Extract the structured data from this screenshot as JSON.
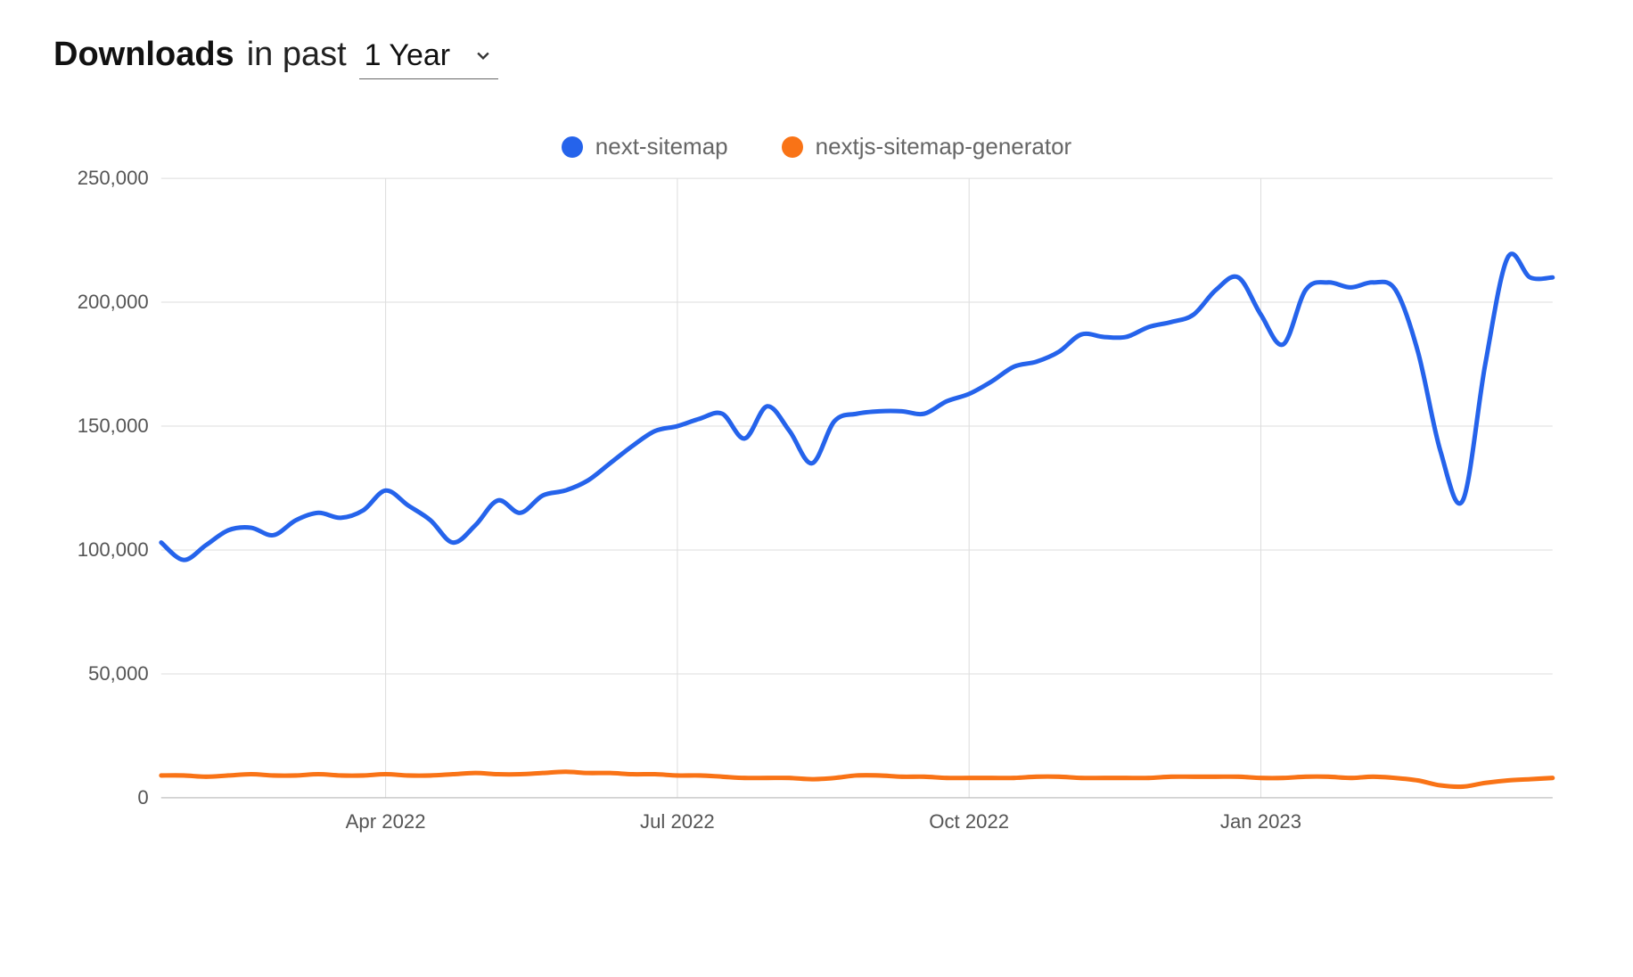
{
  "header": {
    "title_bold": "Downloads",
    "title_light": "in past",
    "period_selected": "1 Year"
  },
  "legend": {
    "items": [
      {
        "name": "next-sitemap",
        "color": "#2563eb"
      },
      {
        "name": "nextjs-sitemap-generator",
        "color": "#f97316"
      }
    ]
  },
  "chart_data": {
    "type": "line",
    "xlabel": "",
    "ylabel": "",
    "ylim": [
      0,
      250000
    ],
    "yticks": [
      0,
      50000,
      100000,
      150000,
      200000,
      250000
    ],
    "xticks": [
      "Apr 2022",
      "Jul 2022",
      "Oct 2022",
      "Jan 2023"
    ],
    "xtick_positions": [
      10,
      23,
      36,
      49
    ],
    "series": [
      {
        "name": "next-sitemap",
        "color": "#2563eb",
        "values": [
          103000,
          96000,
          102000,
          108000,
          109000,
          106000,
          112000,
          115000,
          113000,
          116000,
          124000,
          118000,
          112000,
          103000,
          110000,
          120000,
          115000,
          122000,
          124000,
          128000,
          135000,
          142000,
          148000,
          150000,
          153000,
          155000,
          145000,
          158000,
          148000,
          135000,
          152000,
          155000,
          156000,
          156000,
          155000,
          160000,
          163000,
          168000,
          174000,
          176000,
          180000,
          187000,
          186000,
          186000,
          190000,
          192000,
          195000,
          205000,
          210000,
          195000,
          183000,
          205000,
          208000,
          206000,
          208000,
          205000,
          180000,
          140000,
          120000,
          175000,
          218000,
          210000,
          210000
        ]
      },
      {
        "name": "nextjs-sitemap-generator",
        "color": "#f97316",
        "values": [
          9000,
          9000,
          8500,
          9000,
          9500,
          9000,
          9000,
          9500,
          9000,
          9000,
          9500,
          9000,
          9000,
          9500,
          10000,
          9500,
          9500,
          10000,
          10500,
          10000,
          10000,
          9500,
          9500,
          9000,
          9000,
          8500,
          8000,
          8000,
          8000,
          7500,
          8000,
          9000,
          9000,
          8500,
          8500,
          8000,
          8000,
          8000,
          8000,
          8500,
          8500,
          8000,
          8000,
          8000,
          8000,
          8500,
          8500,
          8500,
          8500,
          8000,
          8000,
          8500,
          8500,
          8000,
          8500,
          8000,
          7000,
          5000,
          4500,
          6000,
          7000,
          7500,
          8000
        ]
      }
    ]
  }
}
